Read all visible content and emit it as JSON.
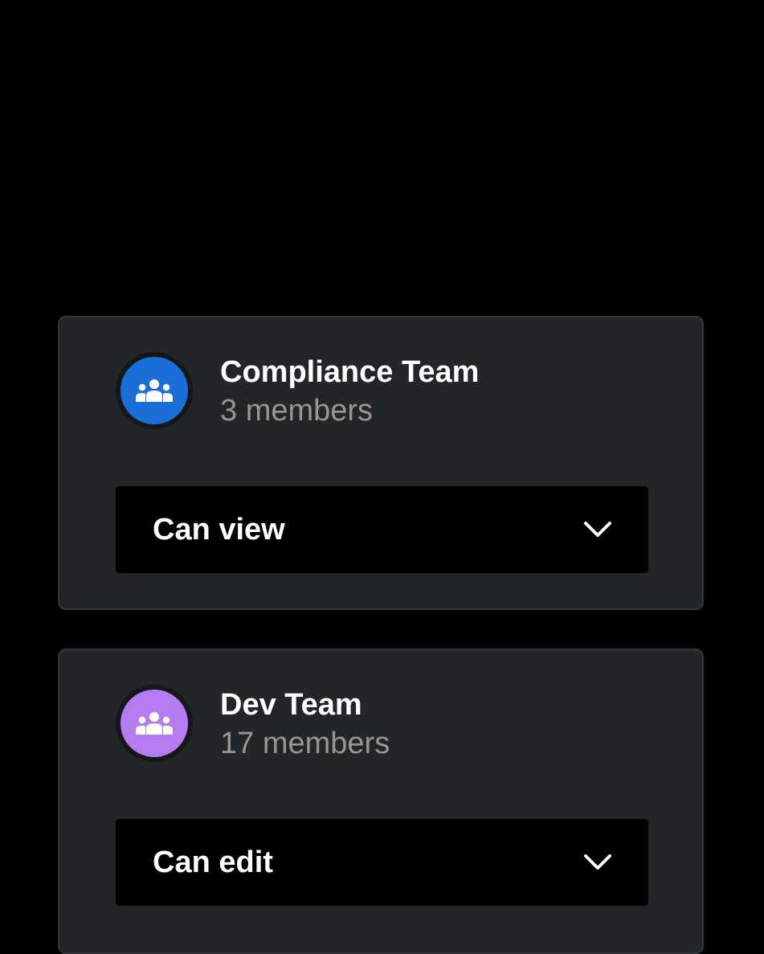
{
  "teams": [
    {
      "name": "Compliance Team",
      "members": "3 members",
      "avatar_icon": "team-icon",
      "avatar_color": "#1a6ed8",
      "permission": "Can view",
      "dropdown_icon": "chevron-down-icon"
    },
    {
      "name": "Dev Team",
      "members": "17 members",
      "avatar_icon": "team-icon",
      "avatar_color": "#b57bf0",
      "permission": "Can edit",
      "dropdown_icon": "chevron-down-icon"
    }
  ],
  "colors": {
    "background": "#000000",
    "card": "#232629",
    "card_border": "#33373b",
    "text_primary": "#ffffff",
    "text_secondary": "#9a9590"
  }
}
